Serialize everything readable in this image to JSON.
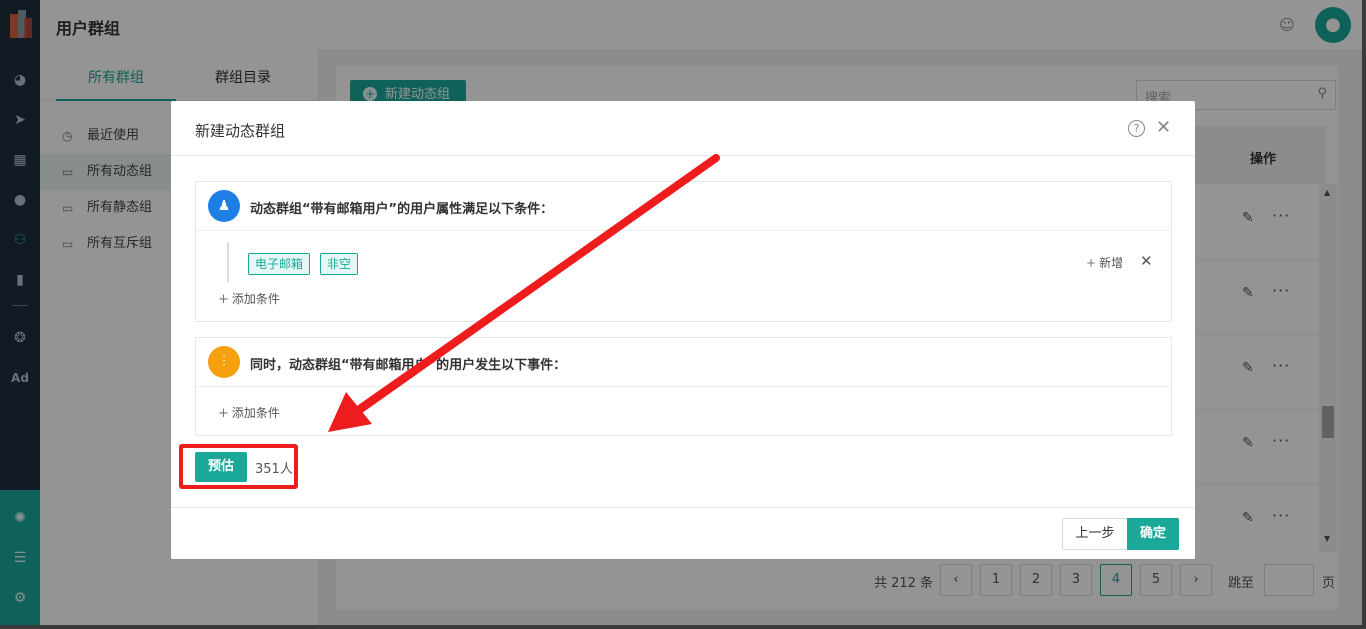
{
  "header": {
    "title": "用户群组"
  },
  "sidebar": {
    "tabs": [
      {
        "label": "所有群组",
        "active": true
      },
      {
        "label": "群组目录",
        "active": false
      }
    ],
    "items": [
      {
        "label": "最近使用",
        "icon": "clock-icon"
      },
      {
        "label": "所有动态组",
        "icon": "folder-icon",
        "active": true
      },
      {
        "label": "所有静态组",
        "icon": "folder-icon"
      },
      {
        "label": "所有互斥组",
        "icon": "folder-icon"
      }
    ]
  },
  "rail": {
    "icons": [
      "dashboard-icon",
      "send-icon",
      "layout-icon",
      "user-icon",
      "user-group-icon",
      "bar-chart-icon",
      "wechat-icon",
      "ad-icon",
      "network-icon",
      "server-icon",
      "gear-icon"
    ],
    "ad_label": "Ad"
  },
  "content": {
    "new_button": "新建动态组",
    "search_placeholder": "搜索",
    "column_action": "操作",
    "pagination": {
      "total": "共 212 条",
      "pages": [
        "1",
        "2",
        "3",
        "4",
        "5"
      ],
      "current": "4",
      "jump_label": "跳至",
      "page_suffix": "页"
    }
  },
  "dialog": {
    "title": "新建动态群组",
    "condition_title": "动态群组“带有邮箱用户”的用户属性满足以下条件：",
    "condition_tags": [
      "电子邮箱",
      "非空"
    ],
    "add_condition": "添加条件",
    "new_label": "新增",
    "event_title": "同时，动态群组“带有邮箱用户”的用户发生以下事件：",
    "estimate_button": "预估",
    "estimate_value": "351人",
    "prev_button": "上一步",
    "confirm_button": "确定"
  },
  "colors": {
    "accent": "#1aa999",
    "annotation": "#ee1c1c",
    "condition_icon": "#1e7ee6",
    "event_icon": "#f5a00c"
  }
}
